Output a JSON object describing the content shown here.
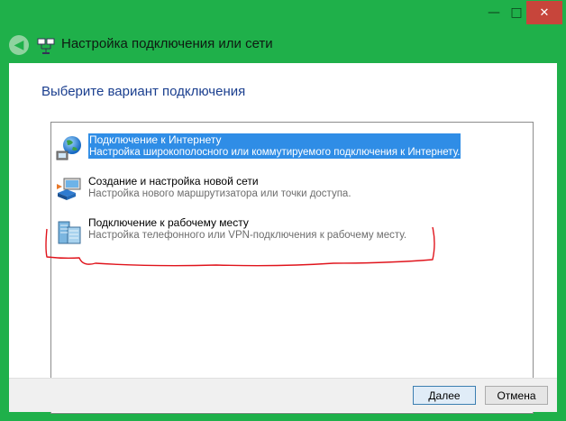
{
  "window": {
    "controls": {
      "minimize": "—",
      "maximize": "□",
      "close": "✕"
    }
  },
  "header": {
    "back_icon": "back-arrow-icon",
    "title": "Настройка подключения или сети"
  },
  "main": {
    "instruction": "Выберите вариант подключения",
    "options": [
      {
        "title": "Подключение к Интернету",
        "description": "Настройка широкополосного или коммутируемого подключения к Интернету.",
        "icon": "globe-network-icon",
        "selected": true
      },
      {
        "title": "Создание и настройка новой сети",
        "description": "Настройка нового маршрутизатора или точки доступа.",
        "icon": "router-icon",
        "selected": false
      },
      {
        "title": "Подключение к рабочему месту",
        "description": "Настройка телефонного или VPN-подключения к рабочему месту.",
        "icon": "workplace-icon",
        "selected": false
      }
    ]
  },
  "footer": {
    "next_label": "Далее",
    "cancel_label": "Отмена"
  },
  "colors": {
    "frame": "#1fb04a",
    "selection": "#2f8de6",
    "instruction_text": "#1b3f8f",
    "annotation": "#e0141c"
  }
}
